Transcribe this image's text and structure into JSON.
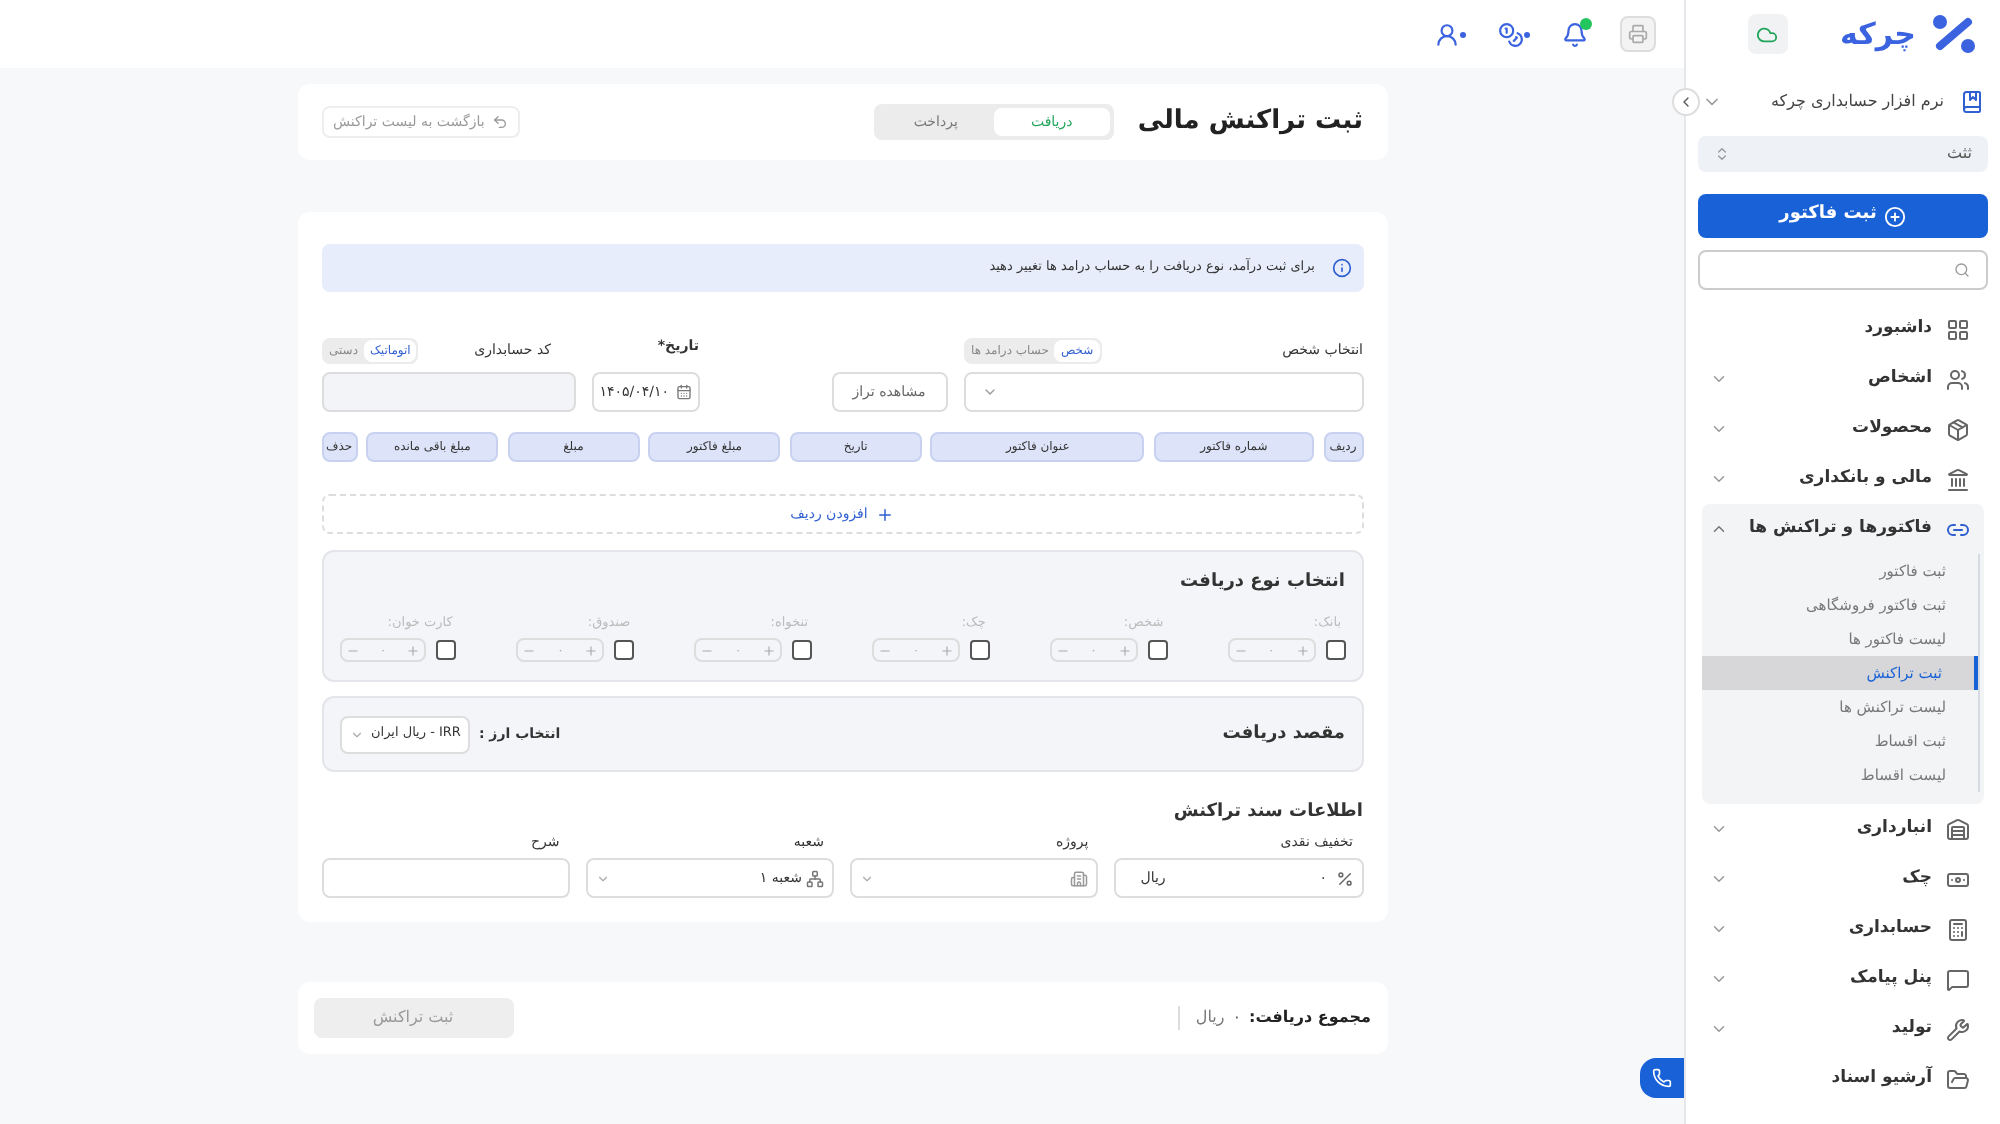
{
  "brand": {
    "name": "چرکه"
  },
  "sidebar": {
    "company": "نرم افزار حسابداری چرکه",
    "period": "ثثث",
    "primary_button": "ثبت فاکتور",
    "items": [
      {
        "kind": "link",
        "label": "داشبورد",
        "expanded": false
      },
      {
        "kind": "group",
        "label": "اشخاص",
        "expanded": false
      },
      {
        "kind": "group",
        "label": "محصولات",
        "expanded": false
      },
      {
        "kind": "group",
        "label": "مالی و بانکداری",
        "expanded": false
      },
      {
        "kind": "group",
        "label": "فاکتورها و تراکنش ها",
        "expanded": true,
        "children": [
          {
            "label": "ثبت فاکتور",
            "selected": false
          },
          {
            "label": "ثبت فاکتور فروشگاهی",
            "selected": false
          },
          {
            "label": "لیست فاکتور ها",
            "selected": false
          },
          {
            "label": "ثبت تراکنش",
            "selected": true
          },
          {
            "label": "لیست تراکنش ها",
            "selected": false
          },
          {
            "label": "ثبت اقساط",
            "selected": false
          },
          {
            "label": "لیست اقساط",
            "selected": false
          }
        ]
      },
      {
        "kind": "group",
        "label": "انبارداری",
        "expanded": false
      },
      {
        "kind": "group",
        "label": "چک",
        "expanded": false
      },
      {
        "kind": "group",
        "label": "حسابداری",
        "expanded": false
      },
      {
        "kind": "group",
        "label": "پنل پیامک",
        "expanded": false
      },
      {
        "kind": "group",
        "label": "تولید",
        "expanded": false
      },
      {
        "kind": "link",
        "label": "آرشیو اسناد",
        "expanded": false
      }
    ]
  },
  "page": {
    "title": "ثبت تراکنش مالی",
    "tabs": [
      {
        "label": "دریافت",
        "selected": true
      },
      {
        "label": "پرداخت",
        "selected": false
      }
    ],
    "back": "بازگشت به لیست تراکنش"
  },
  "notice": "برای ثبت درآمد، نوع دریافت را به حساب درامد ها تغییر دهید",
  "person": {
    "label": "انتخاب شخص",
    "modes": [
      {
        "label": "شخص",
        "selected": true
      },
      {
        "label": "حساب درامد ها",
        "selected": false
      }
    ],
    "balance_button": "مشاهده تراز"
  },
  "date": {
    "label": "تاریخ*",
    "value": "۱۴۰۵/۰۴/۱۰"
  },
  "code": {
    "label": "کد حسابداری",
    "modes": [
      {
        "label": "اتوماتیک",
        "selected": true
      },
      {
        "label": "دستی",
        "selected": false
      }
    ]
  },
  "table": {
    "columns": [
      "ردیف",
      "شماره فاکتور",
      "عنوان فاکتور",
      "تاریخ",
      "مبلغ فاکتور",
      "مبلغ",
      "مبلغ باقی مانده",
      "حذف"
    ]
  },
  "add_row": "افزودن ردیف",
  "payment_types": {
    "title": "انتخاب نوع دریافت",
    "items": [
      {
        "label": "بانک:",
        "checked": false,
        "value": "۰"
      },
      {
        "label": "شخص:",
        "checked": false,
        "value": "۰"
      },
      {
        "label": "چک:",
        "checked": false,
        "value": "۰"
      },
      {
        "label": "تنخواه:",
        "checked": false,
        "value": "۰"
      },
      {
        "label": "صندوق:",
        "checked": false,
        "value": "۰"
      },
      {
        "label": "کارت خوان:",
        "checked": false,
        "value": "۰"
      }
    ]
  },
  "destination": {
    "title": "مقصد دریافت",
    "currency_label": "انتخاب ارز :",
    "currency": "IRR - ریال ایران"
  },
  "document": {
    "title": "اطلاعات سند تراکنش",
    "fields": [
      {
        "kind": "amount",
        "label": "تخفیف نقدی",
        "value": "۰",
        "unit": "ریال"
      },
      {
        "kind": "project",
        "label": "پروژه"
      },
      {
        "kind": "branch",
        "label": "شعبه",
        "value": "شعبه ۱"
      },
      {
        "kind": "text",
        "label": "شرح"
      }
    ]
  },
  "footer": {
    "total_label": "مجموع دریافت:",
    "total": "۰",
    "unit": "ریال",
    "submit": {
      "label": "ثبت تراکنش",
      "disabled": true
    }
  }
}
